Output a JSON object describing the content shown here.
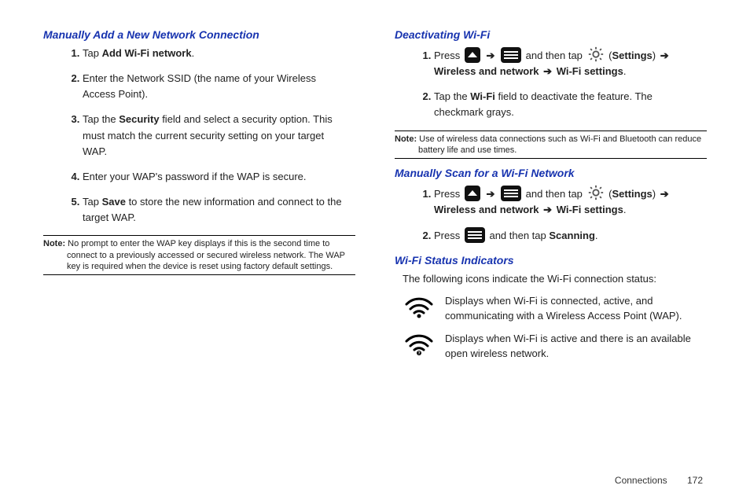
{
  "left": {
    "heading": "Manually Add a New Network Connection",
    "steps": {
      "s1a": "Tap ",
      "s1b": "Add Wi-Fi network",
      "s1c": ".",
      "s2": "Enter the Network SSID (the name of your Wireless Access Point).",
      "s3a": "Tap the ",
      "s3b": "Security",
      "s3c": " field and select a security option. This must match the current security setting on your target WAP.",
      "s4": "Enter your WAP's password if the WAP is secure.",
      "s5a": "Tap ",
      "s5b": "Save",
      "s5c": " to store the new information and connect to the target WAP."
    },
    "note_label": "Note:",
    "note_body": " No prompt to enter the WAP key displays if this is the second time to connect to a previously accessed or secured wireless network. The WAP key is required when the device is reset using factory default settings."
  },
  "right": {
    "deact_heading": "Deactivating Wi-Fi",
    "arrow": "➔",
    "d1a": "Press ",
    "d1b": " and then tap ",
    "d1c": " (",
    "d1d": "Settings",
    "d1e": ") ",
    "d1f": "Wireless and network",
    "d1g": "Wi-Fi settings",
    "d1h": ".",
    "d2a": "Tap the ",
    "d2b": "Wi-Fi",
    "d2c": " field to deactivate the feature. The checkmark grays.",
    "note_label": "Note:",
    "note_body": " Use of wireless data connections such as Wi-Fi and Bluetooth can reduce battery life and use times.",
    "scan_heading": "Manually Scan for a Wi-Fi Network",
    "s2a": "Press ",
    "s2b": " and then tap ",
    "s2c": "Scanning",
    "s2d": ".",
    "status_heading": "Wi-Fi Status Indicators",
    "status_intro": "The following icons indicate the Wi-Fi connection status:",
    "status1": "Displays when Wi-Fi is connected, active, and communicating with a Wireless Access Point (WAP).",
    "status2": "Displays when Wi-Fi is active and there is an available open wireless network."
  },
  "footer": {
    "section": "Connections",
    "page": "172"
  }
}
